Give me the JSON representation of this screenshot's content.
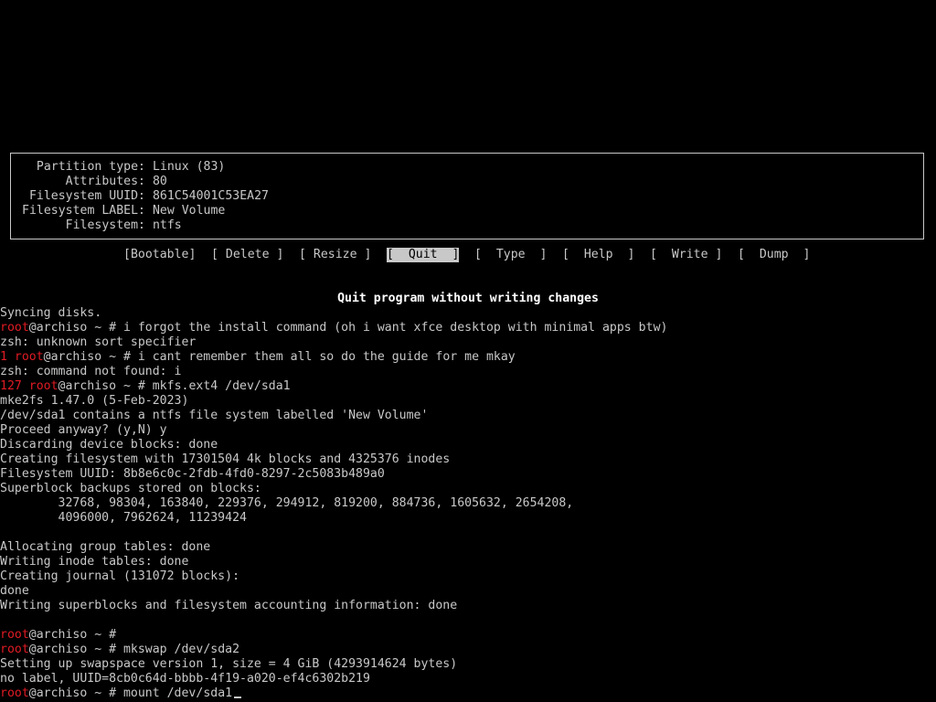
{
  "partition_info": {
    "rows": [
      {
        "key": "Partition type:",
        "value": "Linux (83)"
      },
      {
        "key": "Attributes:",
        "value": "80"
      },
      {
        "key": "Filesystem UUID:",
        "value": "861C54001C53EA27"
      },
      {
        "key": "Filesystem LABEL:",
        "value": "New Volume"
      },
      {
        "key": "Filesystem:",
        "value": "ntfs"
      }
    ]
  },
  "menu": {
    "bootable": "[Bootable]",
    "delete": "[ Delete ]",
    "resize": "[ Resize ]",
    "quit": "[  Quit  ]",
    "type": "[  Type  ]",
    "help": "[  Help  ]",
    "write": "[  Write ]",
    "dump": "[  Dump  ]",
    "selected": "quit"
  },
  "status_message": "Quit program without writing changes",
  "colors": {
    "foreground": "#c8c8c8",
    "background": "#000000",
    "error_red": "#e01b24",
    "highlight": "#ffffff"
  },
  "terminal": {
    "lines": [
      {
        "segments": [
          {
            "text": "Syncing disks.",
            "color": "white"
          }
        ]
      },
      {
        "segments": [
          {
            "text": "root",
            "color": "red"
          },
          {
            "text": "@archiso ~ # i forgot the install command (oh i want xfce desktop with minimal apps btw)",
            "color": "white"
          }
        ]
      },
      {
        "segments": [
          {
            "text": "zsh: unknown sort specifier",
            "color": "white"
          }
        ]
      },
      {
        "segments": [
          {
            "text": "1 root",
            "color": "red"
          },
          {
            "text": "@archiso ~ # i cant remember them all so do the guide for me mkay",
            "color": "white"
          }
        ]
      },
      {
        "segments": [
          {
            "text": "zsh: command not found: i",
            "color": "white"
          }
        ]
      },
      {
        "segments": [
          {
            "text": "127 root",
            "color": "red"
          },
          {
            "text": "@archiso ~ # mkfs.ext4 /dev/sda1",
            "color": "white"
          }
        ]
      },
      {
        "segments": [
          {
            "text": "mke2fs 1.47.0 (5-Feb-2023)",
            "color": "white"
          }
        ]
      },
      {
        "segments": [
          {
            "text": "/dev/sda1 contains a ntfs file system labelled 'New Volume'",
            "color": "white"
          }
        ]
      },
      {
        "segments": [
          {
            "text": "Proceed anyway? (y,N) y",
            "color": "white"
          }
        ]
      },
      {
        "segments": [
          {
            "text": "Discarding device blocks: done",
            "color": "white"
          }
        ]
      },
      {
        "segments": [
          {
            "text": "Creating filesystem with 17301504 4k blocks and 4325376 inodes",
            "color": "white"
          }
        ]
      },
      {
        "segments": [
          {
            "text": "Filesystem UUID: 8b8e6c0c-2fdb-4fd0-8297-2c5083b489a0",
            "color": "white"
          }
        ]
      },
      {
        "segments": [
          {
            "text": "Superblock backups stored on blocks:",
            "color": "white"
          }
        ]
      },
      {
        "segments": [
          {
            "text": "        32768, 98304, 163840, 229376, 294912, 819200, 884736, 1605632, 2654208,",
            "color": "white"
          }
        ]
      },
      {
        "segments": [
          {
            "text": "        4096000, 7962624, 11239424",
            "color": "white"
          }
        ]
      },
      {
        "segments": [
          {
            "text": "",
            "color": "white"
          }
        ]
      },
      {
        "segments": [
          {
            "text": "Allocating group tables: done",
            "color": "white"
          }
        ]
      },
      {
        "segments": [
          {
            "text": "Writing inode tables: done",
            "color": "white"
          }
        ]
      },
      {
        "segments": [
          {
            "text": "Creating journal (131072 blocks):",
            "color": "white"
          }
        ]
      },
      {
        "segments": [
          {
            "text": "done",
            "color": "white"
          }
        ]
      },
      {
        "segments": [
          {
            "text": "Writing superblocks and filesystem accounting information: done",
            "color": "white"
          }
        ]
      },
      {
        "segments": [
          {
            "text": "",
            "color": "white"
          }
        ]
      },
      {
        "segments": [
          {
            "text": "root",
            "color": "red"
          },
          {
            "text": "@archiso ~ #",
            "color": "white"
          }
        ]
      },
      {
        "segments": [
          {
            "text": "root",
            "color": "red"
          },
          {
            "text": "@archiso ~ # mkswap /dev/sda2",
            "color": "white"
          }
        ]
      },
      {
        "segments": [
          {
            "text": "Setting up swapspace version 1, size = 4 GiB (4293914624 bytes)",
            "color": "white"
          }
        ]
      },
      {
        "segments": [
          {
            "text": "no label, UUID=8cb0c64d-bbbb-4f19-a020-ef4c6302b219",
            "color": "white"
          }
        ]
      },
      {
        "segments": [
          {
            "text": "root",
            "color": "red"
          },
          {
            "text": "@archiso ~ # mount /dev/sda1",
            "color": "white"
          }
        ],
        "cursor": true
      }
    ]
  }
}
